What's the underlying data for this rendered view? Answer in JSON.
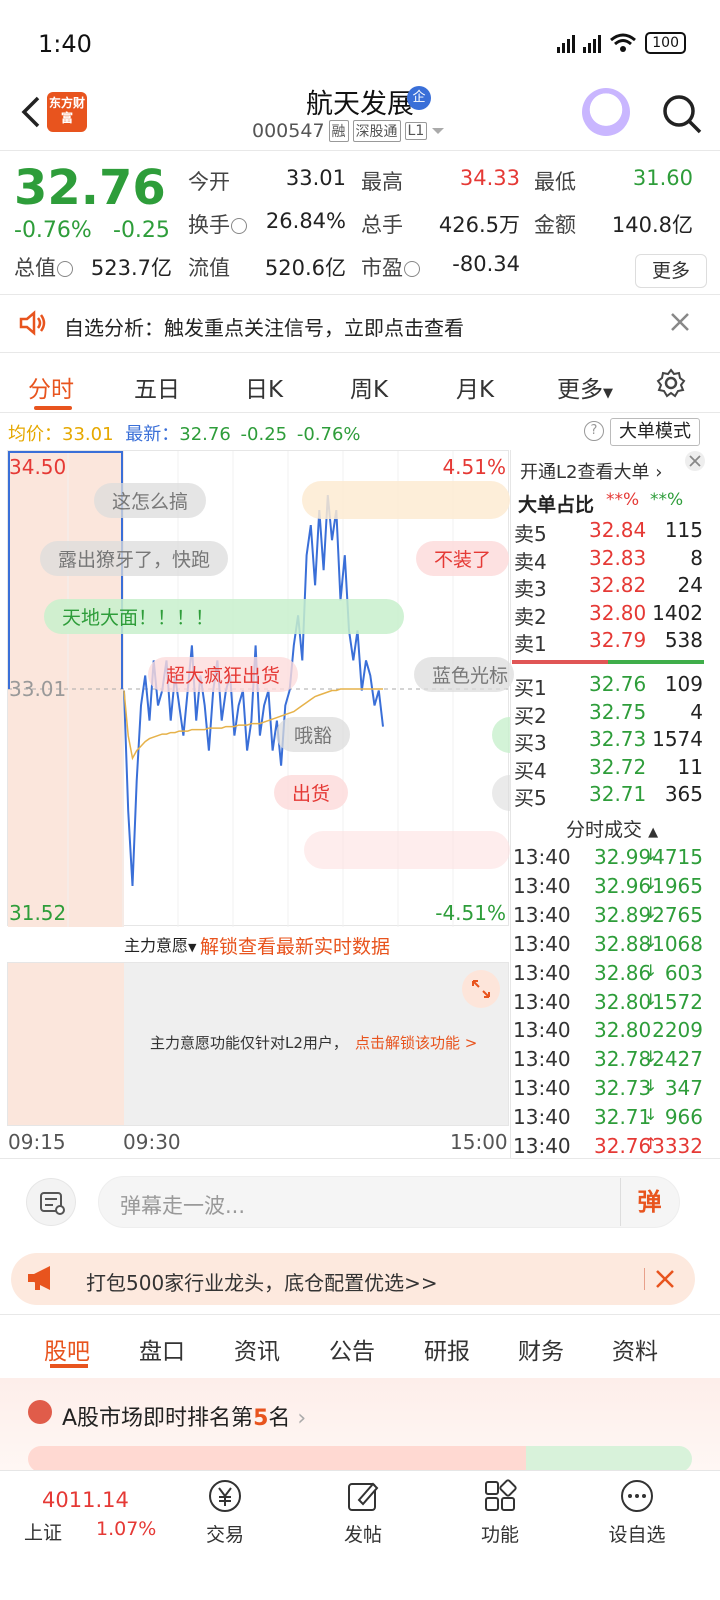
{
  "status_bar": {
    "time": "1:40",
    "battery": "100"
  },
  "header": {
    "logo_text": "东方财富",
    "stock_name": "航天发展",
    "verified_badge": "企",
    "code": "000547",
    "tags": [
      "融",
      "深股通",
      "L1"
    ]
  },
  "quote": {
    "price": "32.76",
    "change_pct": "-0.76%",
    "change_amt": "-0.25",
    "rows": [
      [
        {
          "label": "今开",
          "value": "33.01",
          "color": "#222222"
        },
        {
          "label": "最高",
          "value": "34.33",
          "color": "#e53935"
        },
        {
          "label": "最低",
          "value": "31.60",
          "color": "#2e9d3a"
        }
      ],
      [
        {
          "label": "换手",
          "value": "26.84%",
          "color": "#222222"
        },
        {
          "label": "总手",
          "value": "426.5万",
          "color": "#222222"
        },
        {
          "label": "金额",
          "value": "140.8亿",
          "color": "#222222"
        }
      ],
      [
        {
          "label": "总值",
          "value": "523.7亿",
          "color": "#222222"
        },
        {
          "label": "流值",
          "value": "520.6亿",
          "color": "#222222"
        },
        {
          "label": "市盈",
          "value": "-80.34",
          "color": "#222222"
        }
      ]
    ],
    "more_label": "更多"
  },
  "alert": {
    "text": "自选分析：触发重点关注信号，立即点击查看"
  },
  "chart_tabs": {
    "items": [
      "分时",
      "五日",
      "日K",
      "周K",
      "月K",
      "更多"
    ],
    "active": "分时"
  },
  "avg_bar": {
    "avg_label": "均价：",
    "avg_value": "33.01",
    "latest_label": "最新：",
    "latest_value": "32.76",
    "change": "-0.25",
    "change_pct": "-0.76%",
    "big_order_mode": "大单模式"
  },
  "chart_data": {
    "type": "line",
    "x_start": "09:15",
    "x_open": "09:30",
    "x_end": "15:00",
    "ylim": [
      31.52,
      34.5
    ],
    "prev_close": 33.01,
    "pct_top": "4.51%",
    "pct_bottom": "-4.51%",
    "y_labels": {
      "top": "34.50",
      "mid": "33.01",
      "bottom": "31.52"
    },
    "series": [
      {
        "values": [
          33.0,
          32.2,
          31.7,
          32.4,
          32.9,
          33.1,
          32.8,
          33.2,
          32.9,
          33.0,
          33.2,
          32.8,
          33.1,
          32.9,
          32.7,
          33.0,
          33.3,
          32.8,
          33.1,
          32.9,
          32.6,
          33.0,
          33.2,
          32.8,
          33.0,
          33.1,
          32.7,
          32.9,
          33.0,
          32.6,
          32.8,
          33.3,
          32.7,
          32.9,
          33.0,
          32.6,
          32.8,
          32.5,
          32.9,
          33.0,
          33.3,
          33.5,
          33.2,
          33.9,
          34.1,
          33.7,
          34.2,
          33.8,
          34.3,
          34.0,
          34.2,
          33.6,
          33.9,
          33.4,
          33.2,
          33.4,
          33.0,
          33.2,
          33.1,
          32.9,
          33.0,
          32.76
        ]
      },
      {
        "values": [
          33.0,
          32.7,
          32.55,
          32.6,
          32.63,
          32.66,
          32.68,
          32.69,
          32.7,
          32.71,
          32.71,
          32.72,
          32.72,
          32.73,
          32.73,
          32.73,
          32.74,
          32.74,
          32.74,
          32.74,
          32.75,
          32.75,
          32.75,
          32.75,
          32.76,
          32.76,
          32.76,
          32.77,
          32.77,
          32.77,
          32.78,
          32.78,
          32.78,
          32.79,
          32.8,
          32.81,
          32.82,
          32.83,
          32.84,
          32.85,
          32.86,
          32.88,
          32.9,
          32.92,
          32.94,
          32.96,
          32.97,
          32.98,
          32.99,
          33.0,
          33.0,
          33.01,
          33.01,
          33.01,
          33.01,
          33.01,
          33.01,
          33.01,
          33.01,
          33.01,
          33.01,
          33.01
        ]
      }
    ],
    "bullets": [
      "这怎么搞",
      "露出獠牙了，快跑",
      "天地大面！！！！",
      "超大疯狂出货",
      "哦豁",
      "出货",
      "不装了",
      "蓝色光标"
    ]
  },
  "main_intent": {
    "label": "主力意愿",
    "unlock": "解锁查看最新实时数据",
    "notice": "主力意愿功能仅针对L2用户，",
    "notice_link": "点击解锁该功能 >"
  },
  "order_book": {
    "l2_link": "开通L2查看大单",
    "big_ratio_label": "大单占比",
    "big_ratio_red": "**%",
    "big_ratio_green": "**%",
    "asks": [
      {
        "label": "卖5",
        "price": "32.84",
        "vol": "115",
        "color": "#e53935"
      },
      {
        "label": "卖4",
        "price": "32.83",
        "vol": "8",
        "color": "#e53935"
      },
      {
        "label": "卖3",
        "price": "32.82",
        "vol": "24",
        "color": "#e53935"
      },
      {
        "label": "卖2",
        "price": "32.80",
        "vol": "1402",
        "color": "#e53935"
      },
      {
        "label": "卖1",
        "price": "32.79",
        "vol": "538",
        "color": "#e53935"
      }
    ],
    "bids": [
      {
        "label": "买1",
        "price": "32.76",
        "vol": "109",
        "color": "#2e9d3a"
      },
      {
        "label": "买2",
        "price": "32.75",
        "vol": "4",
        "color": "#2e9d3a"
      },
      {
        "label": "买3",
        "price": "32.73",
        "vol": "1574",
        "color": "#2e9d3a"
      },
      {
        "label": "买4",
        "price": "32.72",
        "vol": "11",
        "color": "#2e9d3a"
      },
      {
        "label": "买5",
        "price": "32.71",
        "vol": "365",
        "color": "#2e9d3a"
      }
    ]
  },
  "ticks": {
    "title": "分时成交",
    "rows": [
      {
        "time": "13:40",
        "price": "32.99",
        "vol": "4715",
        "dir": "↓",
        "color": "#2e9d3a"
      },
      {
        "time": "13:40",
        "price": "32.96",
        "vol": "1965",
        "dir": "↓",
        "color": "#2e9d3a"
      },
      {
        "time": "13:40",
        "price": "32.89",
        "vol": "2765",
        "dir": "↓",
        "color": "#2e9d3a"
      },
      {
        "time": "13:40",
        "price": "32.88",
        "vol": "1068",
        "dir": "↓",
        "color": "#2e9d3a"
      },
      {
        "time": "13:40",
        "price": "32.86",
        "vol": "603",
        "dir": "↓",
        "color": "#2e9d3a"
      },
      {
        "time": "13:40",
        "price": "32.80",
        "vol": "1572",
        "dir": "↓",
        "color": "#2e9d3a"
      },
      {
        "time": "13:40",
        "price": "32.80",
        "vol": "2209",
        "dir": "",
        "color": "#2e9d3a"
      },
      {
        "time": "13:40",
        "price": "32.78",
        "vol": "2427",
        "dir": "↓",
        "color": "#2e9d3a"
      },
      {
        "time": "13:40",
        "price": "32.73",
        "vol": "347",
        "dir": "↓",
        "color": "#2e9d3a"
      },
      {
        "time": "13:40",
        "price": "32.71",
        "vol": "966",
        "dir": "↓",
        "color": "#2e9d3a"
      },
      {
        "time": "13:40",
        "price": "32.76",
        "vol": "3332",
        "dir": "↑",
        "color": "#e53935"
      }
    ]
  },
  "danmaku": {
    "placeholder": "弹幕走一波...",
    "send": "弹"
  },
  "ad": {
    "text": "打包500家行业龙头，底仓配置优选>>"
  },
  "bottom_tabs": {
    "items": [
      "股吧",
      "盘口",
      "资讯",
      "公告",
      "研报",
      "财务",
      "资料"
    ],
    "active": "股吧"
  },
  "rank": {
    "prefix": "A股市场即时排名第",
    "number": "5",
    "suffix": "名"
  },
  "nav": {
    "index_value": "4011.14",
    "index_name": "上证",
    "index_pct": "1.07%",
    "items": [
      "交易",
      "发帖",
      "功能",
      "设自选"
    ]
  }
}
